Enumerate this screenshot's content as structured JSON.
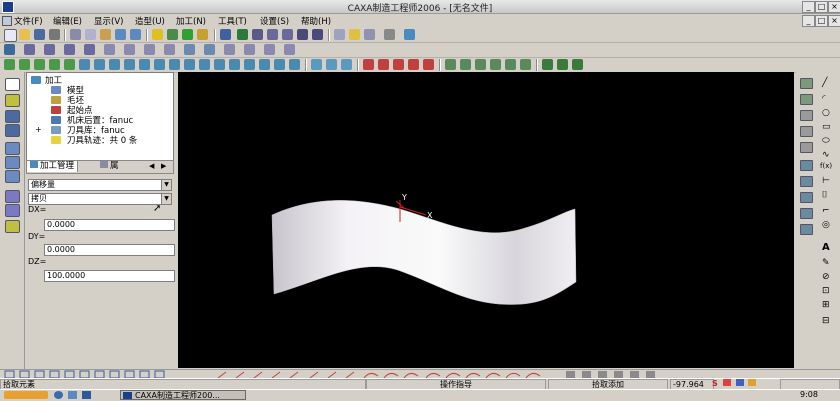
{
  "window": {
    "title": "CAXA制造工程师2006 - [无名文件]"
  },
  "menu": [
    "文件(F)",
    "编辑(E)",
    "显示(V)",
    "造型(U)",
    "加工(N)",
    "工具(T)",
    "设置(S)",
    "帮助(H)"
  ],
  "tree": {
    "root": "加工",
    "items": [
      "模型",
      "毛坯",
      "起始点",
      "机床后置：fanuc",
      "刀具库：fanuc",
      "刀具轨迹：共 0 条"
    ]
  },
  "tabs": {
    "active": "加工管理",
    "second": "属"
  },
  "params": {
    "combo1": "偏移量",
    "combo2": "拷贝",
    "dx_label": "DX=",
    "dx_value": "0.0000",
    "dy_label": "DY=",
    "dy_value": "0.0000",
    "dz_label": "DZ=",
    "dz_value": "100.0000"
  },
  "status": {
    "left": "拾取元素",
    "center": "操作指导",
    "right": "拾取添加",
    "coord": "-97.964"
  },
  "taskbar": {
    "window_button": "CAXA制造工程师200...",
    "clock": "9:08"
  },
  "colors": {
    "viewport": "#000000",
    "surface": "#ececec",
    "chrome": "#d4d0c8"
  }
}
